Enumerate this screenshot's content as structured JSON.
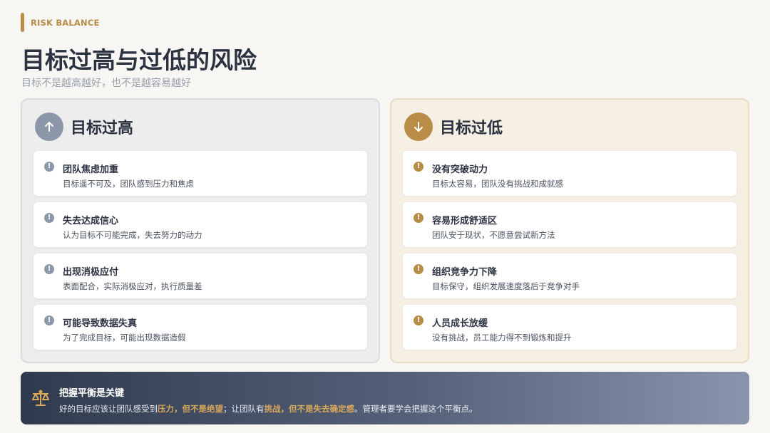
{
  "header": {
    "tag": "RISK BALANCE",
    "title": "目标过高与过低的风险",
    "subtitle": "目标不是越高越好，也不是越容易越好"
  },
  "panels": {
    "high": {
      "title": "目标过高",
      "icon": "arrow-up-icon",
      "accent": "#8d97aa",
      "items": [
        {
          "title": "团队焦虑加重",
          "desc": "目标遥不可及，团队感到压力和焦虑"
        },
        {
          "title": "失去达成信心",
          "desc": "认为目标不可能完成，失去努力的动力"
        },
        {
          "title": "出现消极应付",
          "desc": "表面配合，实际消极应对，执行质量差"
        },
        {
          "title": "可能导致数据失真",
          "desc": "为了完成目标，可能出现数据造假"
        }
      ]
    },
    "low": {
      "title": "目标过低",
      "icon": "arrow-down-icon",
      "accent": "#b98c47",
      "items": [
        {
          "title": "没有突破动力",
          "desc": "目标太容易，团队没有挑战和成就感"
        },
        {
          "title": "容易形成舒适区",
          "desc": "团队安于现状，不愿意尝试新方法"
        },
        {
          "title": "组织竞争力下降",
          "desc": "目标保守，组织发展速度落后于竞争对手"
        },
        {
          "title": "人员成长放缓",
          "desc": "没有挑战，员工能力得不到锻炼和提升"
        }
      ]
    }
  },
  "alert_glyph": "!",
  "bottom": {
    "icon": "scale-balance-icon",
    "title": "把握平衡是关键",
    "parts": [
      "好的目标应该让团队感受到",
      "压力，但不是绝望",
      "；让团队有",
      "挑战，但不是失去确定感",
      "。管理者要学会把握这个平衡点。"
    ]
  },
  "colors": {
    "gold": "#b98c47",
    "slate": "#8d97aa",
    "highlight": "#d8a85c"
  }
}
